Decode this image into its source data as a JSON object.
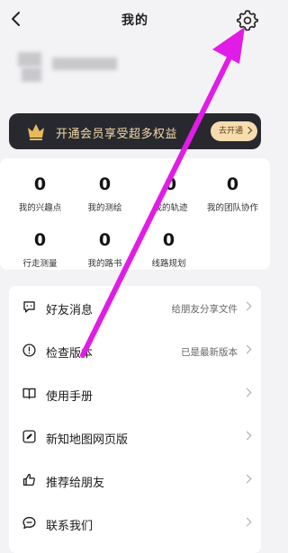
{
  "header": {
    "title": "我的",
    "back_icon": "chevron-left-icon",
    "settings_icon": "gear-icon"
  },
  "vip": {
    "text": "开通会员享受超多权益",
    "button_label": "去开通",
    "icon": "crown-icon",
    "accent": "#f4d9a8"
  },
  "stats": [
    {
      "value": "0",
      "label": "我的兴趣点"
    },
    {
      "value": "0",
      "label": "我的测绘"
    },
    {
      "value": "0",
      "label": "我的轨迹"
    },
    {
      "value": "0",
      "label": "我的团队协作"
    },
    {
      "value": "0",
      "label": "行走测量"
    },
    {
      "value": "0",
      "label": "我的路书"
    },
    {
      "value": "0",
      "label": "线路规划"
    }
  ],
  "menu": [
    {
      "label": "好友消息",
      "sub": "给朋友分享文件",
      "icon": "chat-bubble-icon"
    },
    {
      "label": "检查版本",
      "sub": "已是最新版本",
      "icon": "info-icon"
    },
    {
      "label": "使用手册",
      "sub": "",
      "icon": "book-icon"
    },
    {
      "label": "新知地图网页版",
      "sub": "",
      "icon": "edit-icon"
    },
    {
      "label": "推荐给朋友",
      "sub": "",
      "icon": "thumbs-up-icon"
    },
    {
      "label": "联系我们",
      "sub": "",
      "icon": "message-icon"
    }
  ],
  "annotation": {
    "color": "#e11ce6"
  }
}
